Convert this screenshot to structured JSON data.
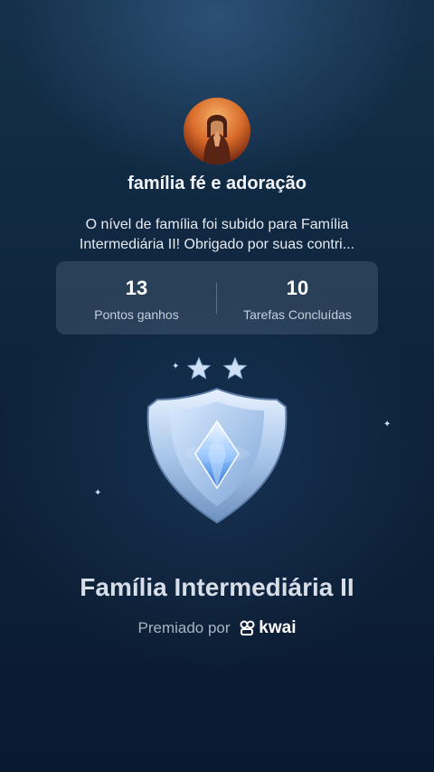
{
  "header": {
    "group_name": "família fé e adoração",
    "message": "O nível de família foi subido para Família Intermediária II! Obrigado por suas contri..."
  },
  "stats": [
    {
      "value": "13",
      "label": "Pontos ganhos"
    },
    {
      "value": "10",
      "label": "Tarefas Concluídas"
    }
  ],
  "badge": {
    "stars": 2,
    "icon": "shield-gem-icon"
  },
  "level": {
    "title": "Família Intermediária II",
    "awarded_by": "Premiado por",
    "brand": "kwai"
  },
  "colors": {
    "accent": "#9fc8ff",
    "background_top": "#15304a",
    "background_bottom": "#0a1a2e"
  }
}
